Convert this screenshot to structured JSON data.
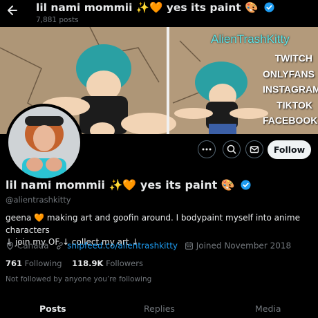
{
  "header": {
    "title": "lil nami mommii ✨🧡 yes its paint 🎨",
    "posts_count": "7,881 posts"
  },
  "banner": {
    "brand": "AlienTrashKitty",
    "platforms": [
      "TWITCH",
      "ONLYFANS",
      "INSTAGRAM",
      "TIKTOK",
      "FACEBOOK"
    ]
  },
  "actions": {
    "follow_label": "Follow"
  },
  "profile": {
    "display_name": "lil nami mommii ✨🧡 yes its paint 🎨",
    "handle": "@alientrashkitty",
    "bio_line1": "geena 🧡 making art and goofin around. I bodypaint myself into anime characters",
    "bio_line2": "↓ join my OF ↓ collect my art ↓",
    "location": "Canada",
    "website": "snipfeed.co/alientrashkitty",
    "joined": "Joined November 2018",
    "following_count": "761",
    "following_label": "Following",
    "followers_count": "118.9K",
    "followers_label": "Followers",
    "not_followed_text": "Not followed by anyone you’re following"
  },
  "tabs": [
    "Posts",
    "Replies",
    "Media"
  ],
  "colors": {
    "accent": "#1d9bf0",
    "verified": "#1d9bf0",
    "muted": "#71767b",
    "background": "#000000"
  }
}
